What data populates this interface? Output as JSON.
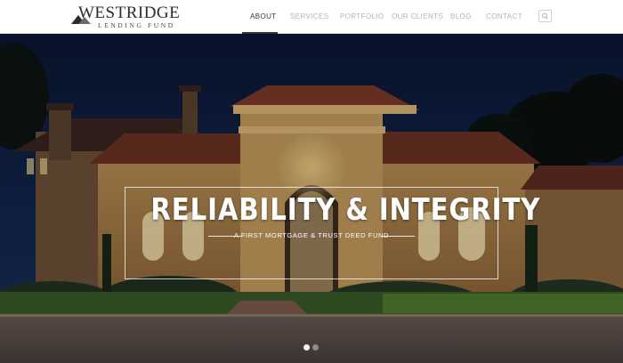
{
  "brand": {
    "name": "WESTRIDGE",
    "tagline": "LENDING FUND"
  },
  "nav": {
    "items": [
      {
        "label": "ABOUT",
        "active": true
      },
      {
        "label": "SERVICES",
        "active": false
      },
      {
        "label": "PORTFOLIO",
        "active": false
      },
      {
        "label": "OUR CLIENTS",
        "active": false
      },
      {
        "label": "BLOG",
        "active": false
      },
      {
        "label": "CONTACT",
        "active": false
      }
    ],
    "search_icon": "search-icon"
  },
  "hero": {
    "title": "RELIABILITY & INTEGRITY",
    "subtitle": "A FIRST MORTGAGE & TRUST DEED FUND",
    "slide_count": 2,
    "active_slide": 1
  },
  "colors": {
    "nav_active": "#333333",
    "nav_inactive": "#b5b5b5",
    "sky": "#0e1d3c"
  }
}
